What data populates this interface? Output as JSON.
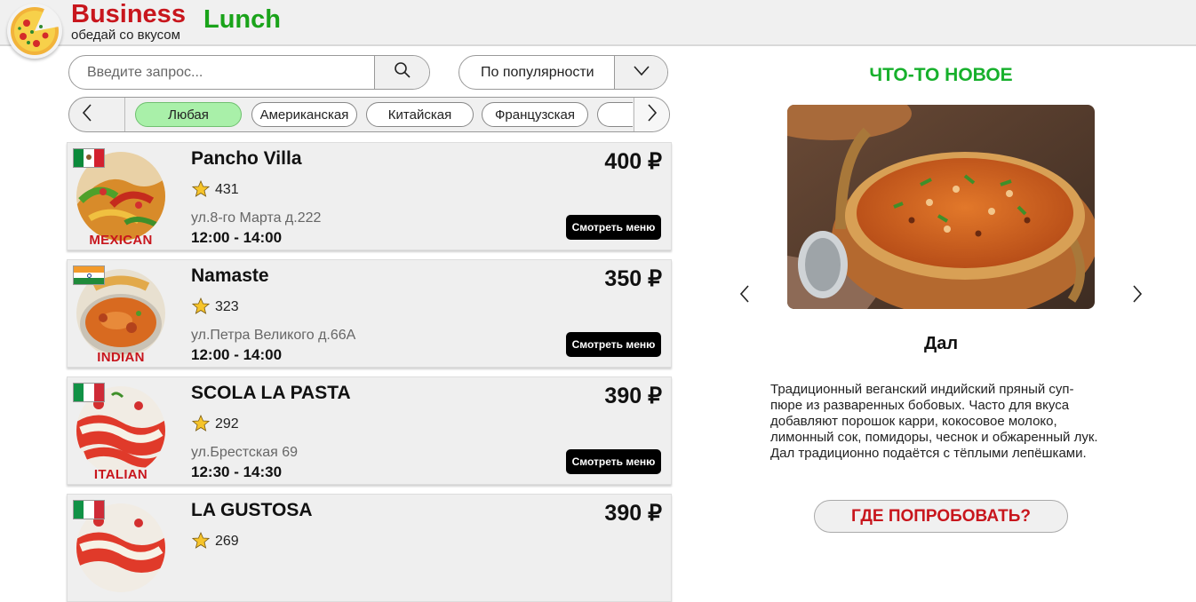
{
  "header": {
    "brand_part1": "Business",
    "brand_part2": "Lunch",
    "tagline": "обедай со вкусом",
    "logo_icon": "pizza-icon"
  },
  "search": {
    "placeholder": "Введите запрос...",
    "value": "",
    "button_icon": "search-icon"
  },
  "sort": {
    "selected": "По популярности",
    "toggle_icon": "chevron-down-icon"
  },
  "categories": {
    "prev_icon": "chevron-left-icon",
    "next_icon": "chevron-right-icon",
    "items": [
      {
        "label": "Любая",
        "active": true
      },
      {
        "label": "Американская",
        "active": false
      },
      {
        "label": "Китайская",
        "active": false
      },
      {
        "label": "Французская",
        "active": false
      }
    ]
  },
  "restaurants": [
    {
      "name": "Pancho Villa",
      "rating": "431",
      "address": "ул.8-го Марта д.222",
      "hours": "12:00 - 14:00",
      "price": "400 ₽",
      "cuisine_label": "MEXICAN",
      "flag": "mexico-flag-icon",
      "menu_button": "Смотреть меню"
    },
    {
      "name": "Namaste",
      "rating": "323",
      "address": "ул.Петра Великого д.66А",
      "hours": "12:00 - 14:00",
      "price": "350 ₽",
      "cuisine_label": "INDIAN",
      "flag": "india-flag-icon",
      "menu_button": "Смотреть меню"
    },
    {
      "name": "SCOLA LA PASTA",
      "rating": "292",
      "address": "ул.Брестская 69",
      "hours": "12:30 - 14:30",
      "price": "390 ₽",
      "cuisine_label": "ITALIAN",
      "flag": "italy-flag-icon",
      "menu_button": "Смотреть меню"
    },
    {
      "name": "LA GUSTOSA",
      "rating": "269",
      "price": "390 ₽",
      "flag": "italy-flag-icon"
    }
  ],
  "featured": {
    "section_title": "ЧТО-ТО НОВОЕ",
    "dish_name": "Дал",
    "description": "Традиционный веганский индийский пряный суп-пюре из разваренных бобовых. Часто для вкуса добавляют порошок карри, кокосовое молоко, лимонный сок, помидоры, чеснок и обжаренный лук. Дал традиционно подаётся с тёплыми лепёшками.",
    "button_label": "ГДЕ ПОПРОБОВАТЬ?",
    "prev_icon": "chevron-left-icon",
    "next_icon": "chevron-right-icon"
  },
  "colors": {
    "brand_red": "#c8161d",
    "brand_green": "#1aa31a",
    "active_chip": "#a9f0a9",
    "card_bg": "#efefef"
  }
}
